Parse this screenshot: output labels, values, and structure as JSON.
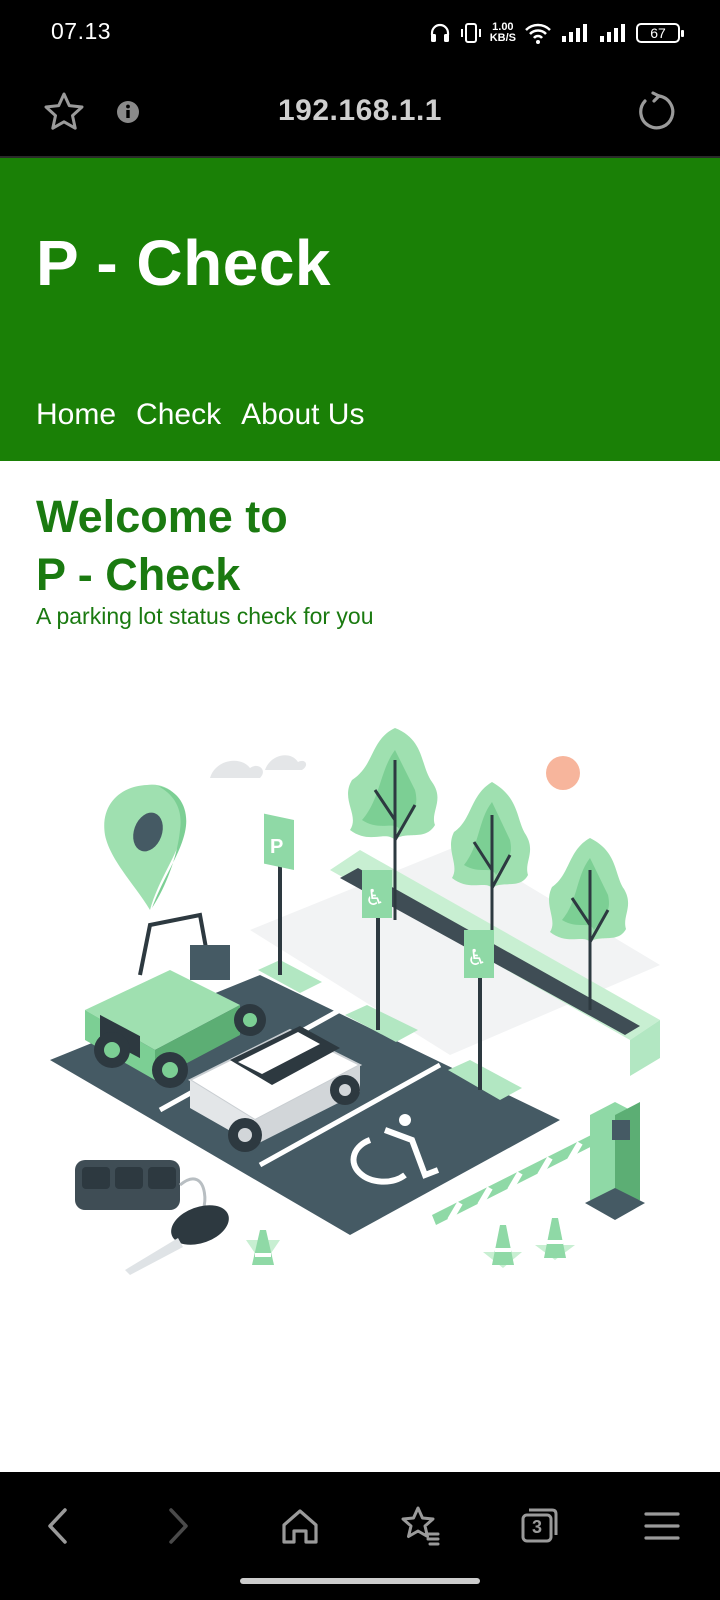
{
  "status_bar": {
    "time": "07.13",
    "speed_value": "1.00",
    "speed_unit": "KB/S",
    "battery": "67",
    "icons": [
      "headphones-icon",
      "vibrate-icon",
      "wifi-icon",
      "signal-icon",
      "signal-icon",
      "battery-icon"
    ]
  },
  "browser": {
    "url": "192.168.1.1",
    "icons": [
      "star-icon",
      "info-icon",
      "reload-icon"
    ]
  },
  "site": {
    "title": "P - Check",
    "nav": [
      "Home",
      "Check",
      "About Us"
    ],
    "welcome_line1": "Welcome to",
    "welcome_line2": "P - Check",
    "tagline": "A parking lot status check for you",
    "illustration": "parking-lot-illustration"
  },
  "bottom_nav": {
    "tabs_count": "3",
    "icons": [
      "back-icon",
      "forward-icon",
      "home-icon",
      "bookmarks-icon",
      "tabs-icon",
      "menu-icon"
    ]
  },
  "colors": {
    "header_green": "#1a8006",
    "text_green": "#1a7a10",
    "mint": "#8fd9a6",
    "asphalt": "#455a64"
  }
}
